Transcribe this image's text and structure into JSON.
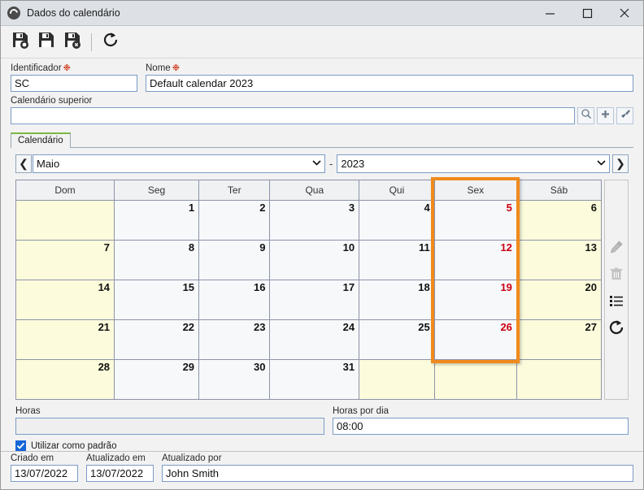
{
  "window": {
    "title": "Dados do calendário",
    "icon": "calendar-app-icon",
    "minimize_label": "—",
    "maximize_label": "□",
    "close_label": "✕"
  },
  "toolbar": {
    "buttons": [
      {
        "name": "save-button",
        "icon": "save-floppy-icon",
        "label": "Salvar"
      },
      {
        "name": "save-all-button",
        "icon": "save-all-floppy-icon",
        "label": "Salvar tudo"
      },
      {
        "name": "save-close-button",
        "icon": "save-close-floppy-icon",
        "label": "Salvar e fechar"
      },
      {
        "name": "refresh-button",
        "icon": "refresh-icon",
        "label": "Atualizar"
      }
    ]
  },
  "form": {
    "identificador": {
      "label": "Identificador",
      "required_mark": "❉",
      "value": "SC"
    },
    "nome": {
      "label": "Nome",
      "required_mark": "❉",
      "value": "Default calendar 2023"
    },
    "calendario_superior": {
      "label": "Calendário superior",
      "value": "",
      "buttons": [
        {
          "name": "search-parent-calendar-button",
          "icon": "search-icon"
        },
        {
          "name": "add-parent-calendar-button",
          "icon": "plus-icon"
        },
        {
          "name": "clear-parent-calendar-button",
          "icon": "brush-icon"
        }
      ]
    }
  },
  "tabs": [
    {
      "label": "Calendário",
      "active": true
    }
  ],
  "period": {
    "prev_label": "❮",
    "next_label": "❯",
    "month": "Maio",
    "separator": "-",
    "year": "2023",
    "dropdown_arrow": "⌄"
  },
  "calendar": {
    "day_headers": [
      "Dom",
      "Seg",
      "Ter",
      "Qua",
      "Qui",
      "Sex",
      "Sáb"
    ],
    "weeks": [
      [
        {
          "day": "",
          "weekend": true,
          "holiday": false
        },
        {
          "day": "1",
          "weekend": false,
          "holiday": false
        },
        {
          "day": "2",
          "weekend": false,
          "holiday": false
        },
        {
          "day": "3",
          "weekend": false,
          "holiday": false
        },
        {
          "day": "4",
          "weekend": false,
          "holiday": false
        },
        {
          "day": "5",
          "weekend": false,
          "holiday": true
        },
        {
          "day": "6",
          "weekend": true,
          "holiday": false
        }
      ],
      [
        {
          "day": "7",
          "weekend": true,
          "holiday": false
        },
        {
          "day": "8",
          "weekend": false,
          "holiday": false
        },
        {
          "day": "9",
          "weekend": false,
          "holiday": false
        },
        {
          "day": "10",
          "weekend": false,
          "holiday": false
        },
        {
          "day": "11",
          "weekend": false,
          "holiday": false
        },
        {
          "day": "12",
          "weekend": false,
          "holiday": true
        },
        {
          "day": "13",
          "weekend": true,
          "holiday": false
        }
      ],
      [
        {
          "day": "14",
          "weekend": true,
          "holiday": false
        },
        {
          "day": "15",
          "weekend": false,
          "holiday": false
        },
        {
          "day": "16",
          "weekend": false,
          "holiday": false
        },
        {
          "day": "17",
          "weekend": false,
          "holiday": false
        },
        {
          "day": "18",
          "weekend": false,
          "holiday": false
        },
        {
          "day": "19",
          "weekend": false,
          "holiday": true
        },
        {
          "day": "20",
          "weekend": true,
          "holiday": false
        }
      ],
      [
        {
          "day": "21",
          "weekend": true,
          "holiday": false
        },
        {
          "day": "22",
          "weekend": false,
          "holiday": false
        },
        {
          "day": "23",
          "weekend": false,
          "holiday": false
        },
        {
          "day": "24",
          "weekend": false,
          "holiday": false
        },
        {
          "day": "25",
          "weekend": false,
          "holiday": false
        },
        {
          "day": "26",
          "weekend": false,
          "holiday": true
        },
        {
          "day": "27",
          "weekend": true,
          "holiday": false
        }
      ],
      [
        {
          "day": "28",
          "weekend": true,
          "holiday": false
        },
        {
          "day": "29",
          "weekend": false,
          "holiday": false
        },
        {
          "day": "30",
          "weekend": false,
          "holiday": false
        },
        {
          "day": "31",
          "weekend": false,
          "holiday": false
        },
        {
          "day": "",
          "weekend": true,
          "holiday": false
        },
        {
          "day": "",
          "weekend": true,
          "holiday": false
        },
        {
          "day": "",
          "weekend": true,
          "holiday": false
        }
      ]
    ],
    "highlight": {
      "column": "Sex",
      "color": "#f08a1c"
    }
  },
  "calendar_sidebar": {
    "buttons": [
      {
        "name": "edit-day-button",
        "icon": "pencil-icon",
        "enabled": false
      },
      {
        "name": "delete-day-button",
        "icon": "trash-icon",
        "enabled": false
      },
      {
        "name": "list-days-button",
        "icon": "list-icon",
        "enabled": true
      },
      {
        "name": "refresh-calendar-button",
        "icon": "refresh-icon",
        "enabled": true
      }
    ]
  },
  "hours": {
    "horas": {
      "label": "Horas",
      "value": "",
      "disabled": true
    },
    "horas_por_dia": {
      "label": "Horas por dia",
      "value": "08:00"
    },
    "default_checkbox": {
      "label": "Utilizar como padrão",
      "checked": true
    }
  },
  "footer": {
    "criado_em": {
      "label": "Criado em",
      "value": "13/07/2022"
    },
    "atualizado_em": {
      "label": "Atualizado em",
      "value": "13/07/2022"
    },
    "atualizado_por": {
      "label": "Atualizado por",
      "value": "John Smith"
    }
  }
}
